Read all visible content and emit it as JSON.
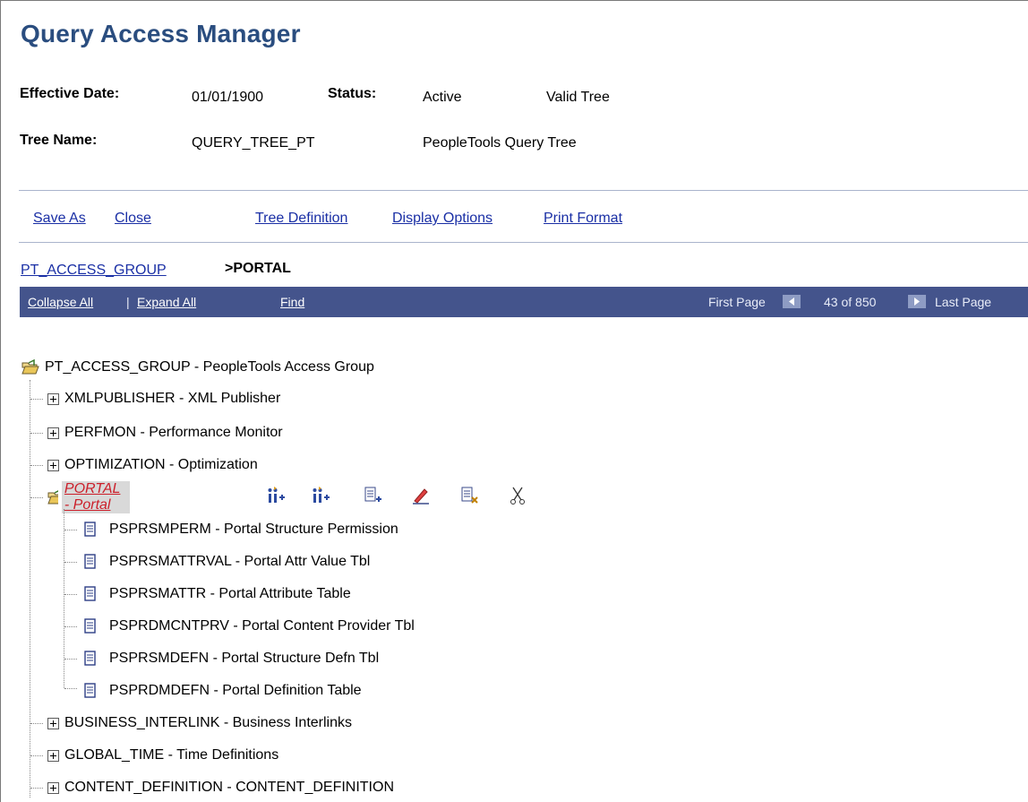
{
  "page": {
    "title": "Query Access Manager"
  },
  "info": {
    "effective_date_label": "Effective Date:",
    "effective_date": "01/01/1900",
    "status_label": "Status:",
    "status": "Active",
    "validity": "Valid Tree",
    "tree_name_label": "Tree Name:",
    "tree_name": "QUERY_TREE_PT",
    "tree_description": "PeopleTools Query Tree"
  },
  "actions": {
    "save_as": "Save As",
    "close": "Close",
    "tree_definition": "Tree Definition",
    "display_options": "Display Options",
    "print_format": "Print Format"
  },
  "breadcrumb": {
    "parent": "PT_ACCESS_GROUP",
    "current": ">PORTAL"
  },
  "navbar": {
    "collapse_all": "Collapse All",
    "separator": "|",
    "expand_all": "Expand All",
    "find": "Find",
    "first_page": "First Page",
    "page_position": "43 of 850",
    "last_page": "Last Page"
  },
  "tree": {
    "root": "PT_ACCESS_GROUP - PeopleTools Access Group",
    "nodes": [
      "XMLPUBLISHER - XML Publisher",
      "PERFMON - Performance Monitor",
      "OPTIMIZATION - Optimization",
      "PORTAL - Portal",
      "BUSINESS_INTERLINK - Business Interlinks",
      "GLOBAL_TIME - Time Definitions",
      "CONTENT_DEFINITION - CONTENT_DEFINITION"
    ],
    "portal_children": [
      "PSPRSMPERM - Portal Structure Permission",
      "PSPRSMATTRVAL - Portal Attr Value Tbl",
      "PSPRSMATTR - Portal Attribute Table",
      "PSPRDMCNTPRV - Portal Content Provider Tbl",
      "PSPRSMDEFN - Portal Structure Defn Tbl",
      "PSPRDMDEFN - Portal Definition Table"
    ]
  },
  "colors": {
    "title": "#2a4d7f",
    "navbar": "#44548c",
    "link": "#1a2fa5",
    "selected": "#cc1f2a"
  }
}
